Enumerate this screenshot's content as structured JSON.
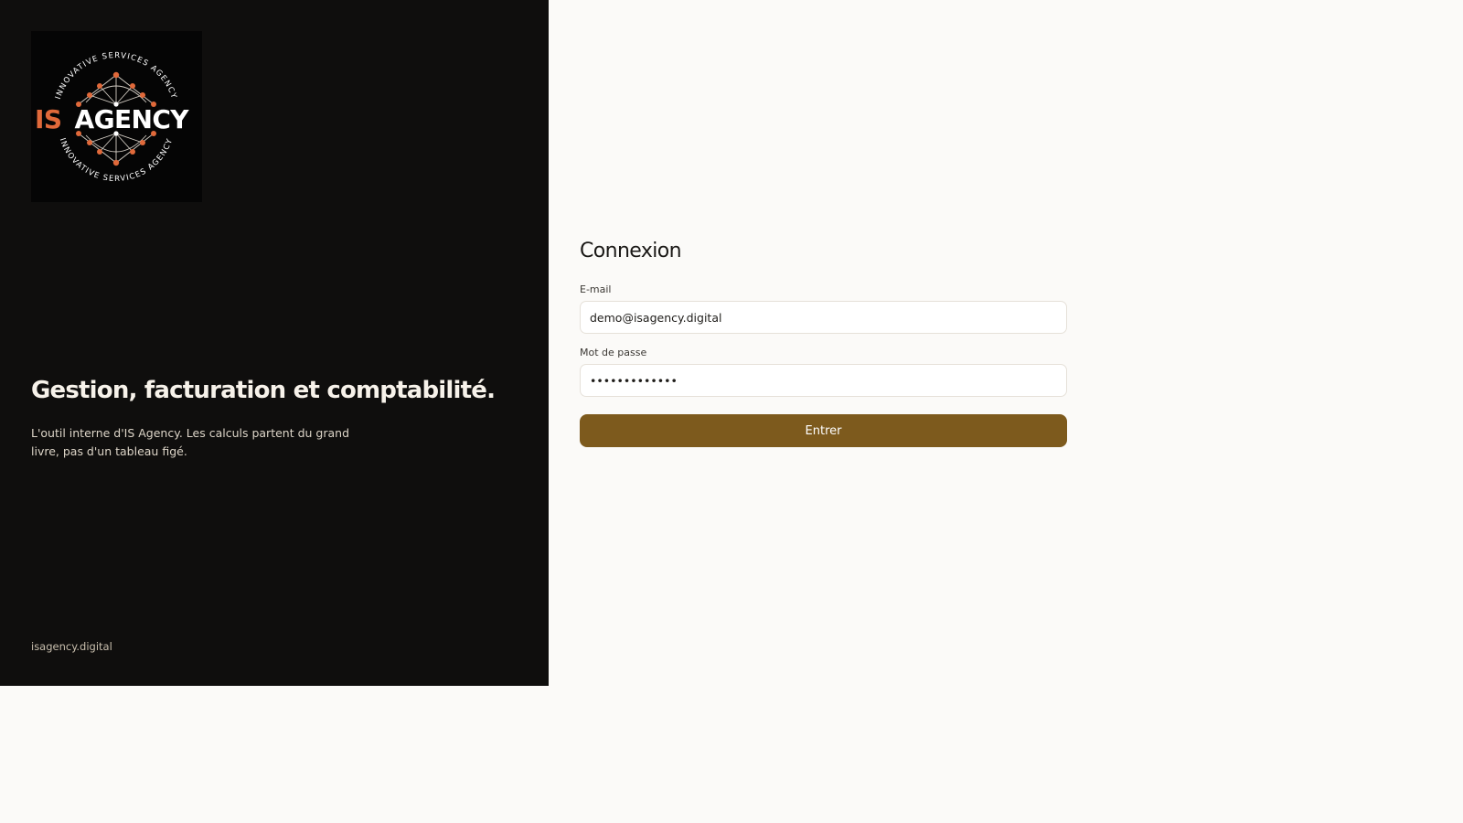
{
  "brand": {
    "logo": {
      "name_accent": "IS",
      "name_main": "AGENCY",
      "ring_text": "INNOVATIVE SERVICES AGENCY",
      "accent_color": "#e0693a",
      "text_color": "#ffffff"
    },
    "tagline": "Gestion, facturation et comptabilité.",
    "description": "L'outil interne d'IS Agency. Les calculs partent du grand livre, pas d'un tableau figé.",
    "footer_link": "isagency.digital"
  },
  "login": {
    "title": "Connexion",
    "email_label": "E-mail",
    "email_value": "demo@isagency.digital",
    "password_label": "Mot de passe",
    "password_value": "demopassword1",
    "submit_label": "Entrer"
  },
  "colors": {
    "panel_background": "#0f0e0d",
    "page_background": "#fbfaf8",
    "button_background": "#7d5a1d"
  }
}
